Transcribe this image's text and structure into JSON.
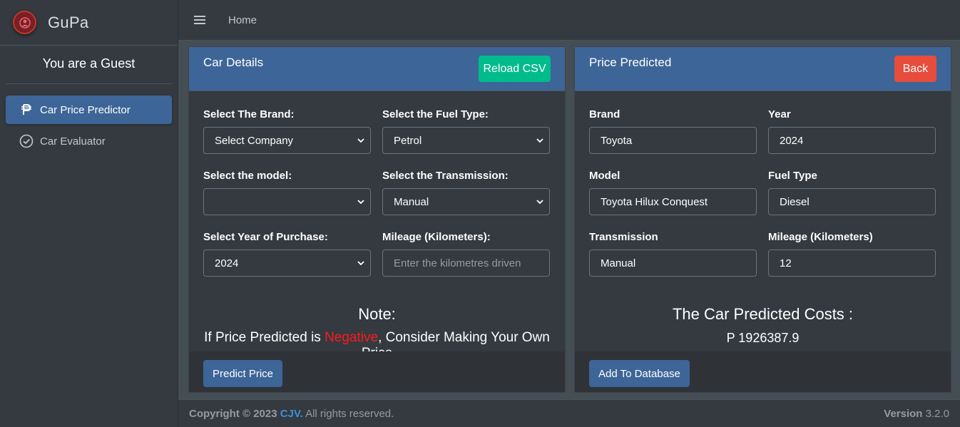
{
  "brand": {
    "name": "GuPa"
  },
  "user": {
    "label": "You are a Guest"
  },
  "sidebar": {
    "items": [
      {
        "label": "Car Price Predictor",
        "icon": "peso-icon",
        "active": true
      },
      {
        "label": "Car Evaluator",
        "icon": "check-circle-icon",
        "active": false
      }
    ]
  },
  "navbar": {
    "home": "Home"
  },
  "car_details": {
    "title": "Car Details",
    "reload_label": "Reload CSV",
    "brand_label": "Select The Brand:",
    "brand_value": "Select Company",
    "fuel_label": "Select the Fuel Type:",
    "fuel_value": "Petrol",
    "model_label": "Select the model:",
    "model_value": "",
    "transmission_label": "Select the Transmission:",
    "transmission_value": "Manual",
    "year_label": "Select Year of Purchase:",
    "year_value": "2024",
    "mileage_label": "Mileage (Kilometers):",
    "mileage_placeholder": "Enter the kilometres driven",
    "note_title": "Note:",
    "note_prefix": "If Price Predicted is ",
    "note_negative": "Negative",
    "note_suffix": ", Consider Making Your Own Price",
    "predict_label": "Predict Price"
  },
  "price_predicted": {
    "title": "Price Predicted",
    "back_label": "Back",
    "brand_label": "Brand",
    "brand_value": "Toyota",
    "year_label": "Year",
    "year_value": "2024",
    "model_label": "Model",
    "model_value": "Toyota Hilux Conquest",
    "fuel_label": "Fuel Type",
    "fuel_value": "Diesel",
    "transmission_label": "Transmission",
    "transmission_value": "Manual",
    "mileage_label": "Mileage (Kilometers)",
    "mileage_value": "12",
    "cost_title": "The Car Predicted Costs :",
    "cost_value": "P 1926387.9",
    "add_label": "Add To Database"
  },
  "footer": {
    "copyright": "Copyright © 2023",
    "company": "CJV.",
    "rights": " All rights reserved.",
    "version_label": "Version",
    "version_value": " 3.2.0"
  },
  "colors": {
    "accent": "#3d6597",
    "success": "#00bc8c",
    "danger": "#e74c3c",
    "negative_text": "#ff1a1a"
  }
}
